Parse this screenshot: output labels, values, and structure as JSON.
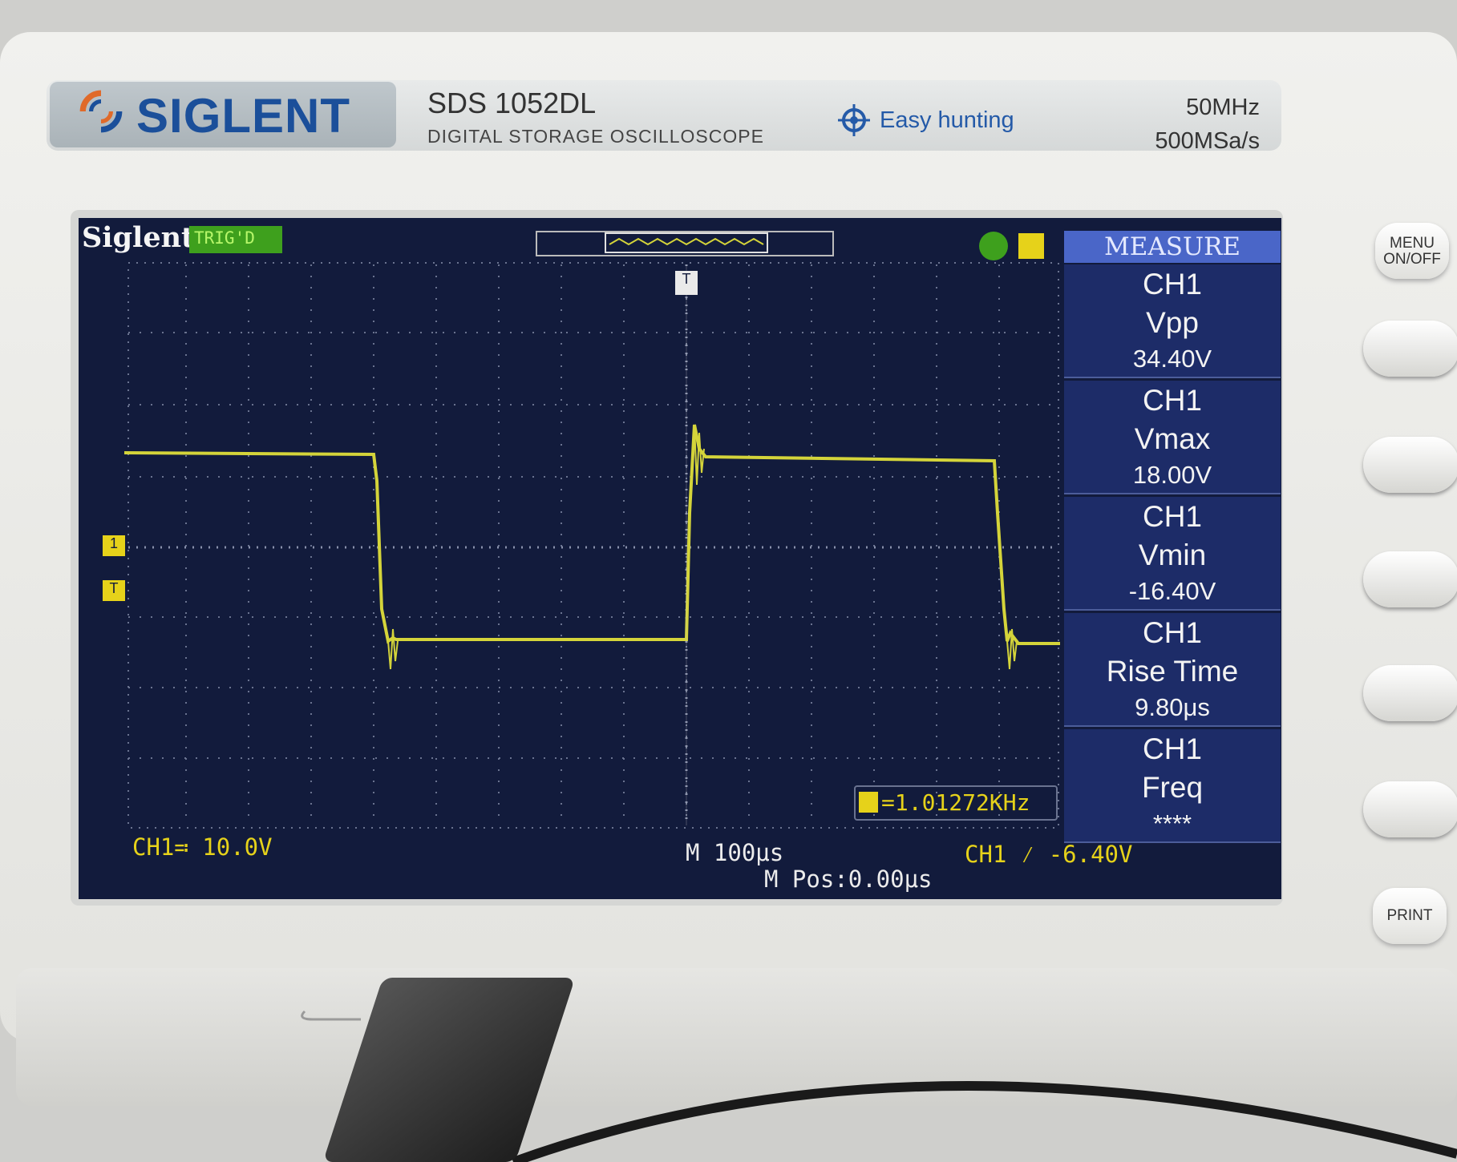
{
  "brand": {
    "name": "SIGLENT",
    "model": "SDS 1052DL",
    "subtitle": "DIGITAL STORAGE OSCILLOSCOPE",
    "easy_label": "Easy hunting",
    "bandwidth": "50MHz",
    "sample_rate": "500MSa/s"
  },
  "screen": {
    "header_logo": "Siglent",
    "trigger_status": "TRIG'D",
    "measure_title": "MEASURE"
  },
  "measurements": [
    {
      "channel": "CH1",
      "name": "Vpp",
      "value": "34.40V"
    },
    {
      "channel": "CH1",
      "name": "Vmax",
      "value": "18.00V"
    },
    {
      "channel": "CH1",
      "name": "Vmin",
      "value": "-16.40V"
    },
    {
      "channel": "CH1",
      "name": "Rise Time",
      "value": "9.80μs"
    },
    {
      "channel": "CH1",
      "name": "Freq",
      "value": "****"
    }
  ],
  "footer": {
    "ch1_scale": "CH1≕ 10.0V",
    "timebase": "M 100μs",
    "mpos": "M Pos:0.00μs",
    "trigger": "CH1 ⁄ -6.40V",
    "freq_counter": "=1.01272KHz"
  },
  "markers": {
    "ch1": "1",
    "trigger_level": "T",
    "trigger_pos": "T"
  },
  "buttons": {
    "menu": "MENU ON/OFF",
    "print": "PRINT"
  },
  "colors": {
    "trace": "#d4d43a",
    "screen_bg": "#121b3c",
    "measure_bg": "#1d2c68",
    "accent_blue": "#1b4f9a"
  }
}
